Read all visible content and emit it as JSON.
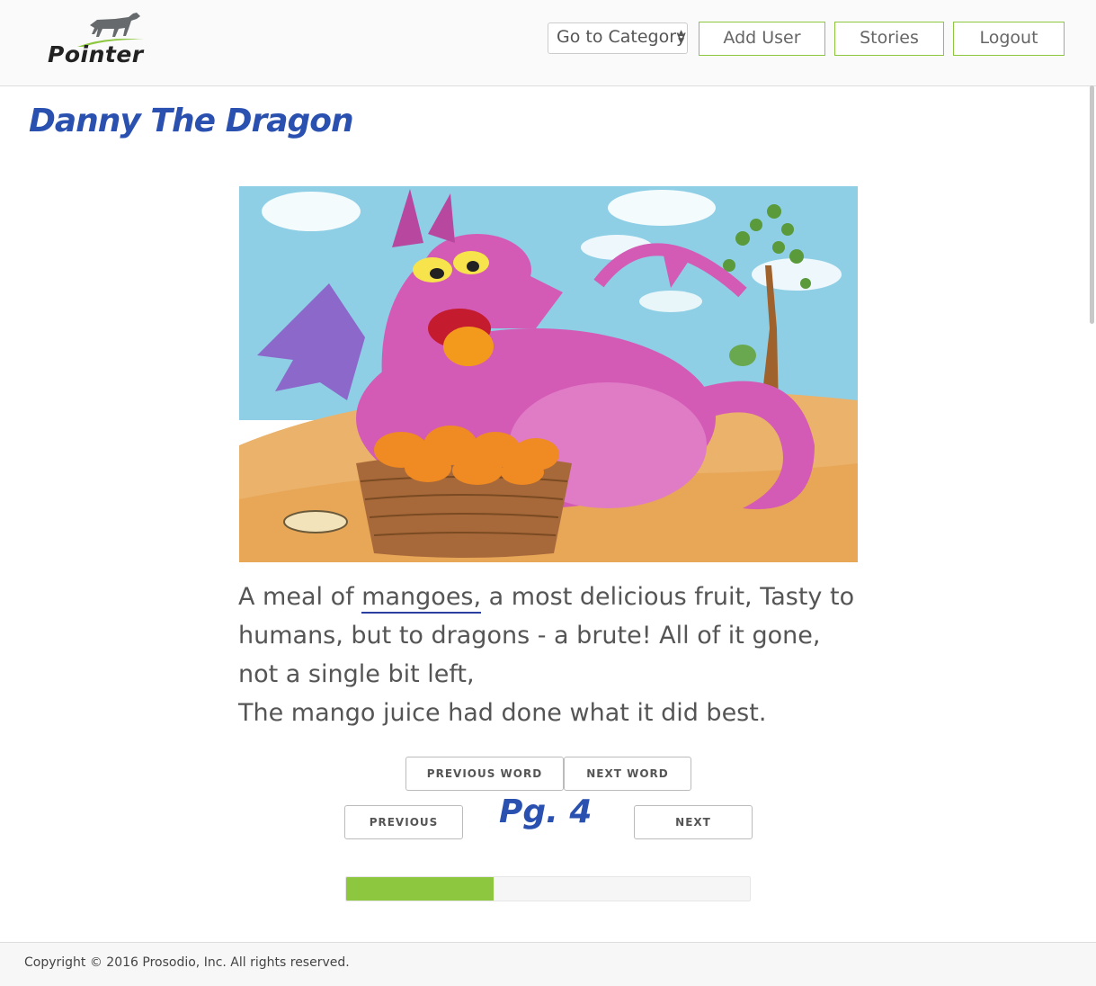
{
  "header": {
    "logo_text": "Pointer",
    "category_select": "Go to Category",
    "add_user": "Add User",
    "stories": "Stories",
    "logout": "Logout"
  },
  "story": {
    "title": "Danny The Dragon",
    "text_before": "A meal of ",
    "highlighted_word": "mangoes,",
    "text_after": " a most delicious fruit, Tasty to humans, but to dragons - a brute! All of it gone, not a single bit left,",
    "line_last": "The mango juice had done what it did best.",
    "page_label": "Pg. 4"
  },
  "nav": {
    "previous_word": "PREVIOUS WORD",
    "next_word": "NEXT WORD",
    "previous": "PREVIOUS",
    "next": "NEXT"
  },
  "progress": {
    "fraction": 0.365
  },
  "footer": {
    "copyright": "Copyright © 2016 Prosodio, Inc. All rights reserved."
  },
  "colors": {
    "accent": "#8dc63f",
    "title_blue": "#2a50b0"
  }
}
